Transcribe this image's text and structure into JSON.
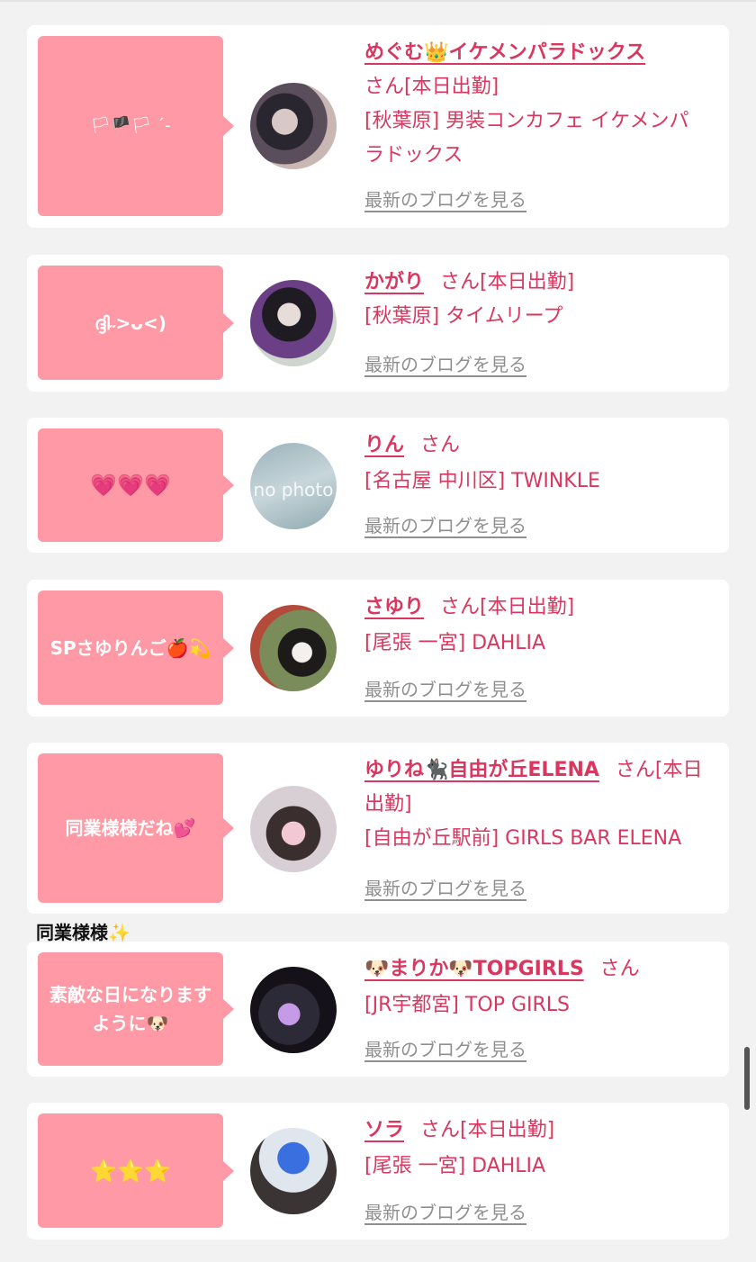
{
  "blog_link_label": "最新のブログを見る",
  "section_label": "同業様様✨",
  "entries": [
    {
      "bubble": "🏳🏴🏳 ˊ-",
      "name": "めぐむ👑イケメンパラドックス",
      "suffix": "さん[本日出勤]",
      "shop": "[秋葉原] 男装コンカフェ イケメンパラドックス"
    },
    {
      "bubble": "ദ്ദി˶>ᴗ<)",
      "name": "かがり",
      "suffix": "さん[本日出勤]",
      "shop": "[秋葉原] タイムリープ"
    },
    {
      "bubble": "💗💗💗",
      "name": "りん",
      "suffix": "さん",
      "shop": "[名古屋 中川区] TWINKLE",
      "avatar_text": "no photo"
    },
    {
      "bubble": "SPさゆりんご🍎💫",
      "name": "さゆり",
      "suffix": "さん[本日出勤]",
      "shop": "[尾張 一宮] DAHLIA"
    },
    {
      "bubble": "同業様様だね💕",
      "name": "ゆりね🐈‍⬛自由が丘ELENA",
      "suffix": "さん[本日出勤]",
      "shop": "[自由が丘駅前] GIRLS BAR ELENA"
    },
    {
      "bubble": "素敵な日になりますように🐶",
      "name": "🐶まりか🐶TOPGIRLS",
      "suffix": "さん",
      "shop": "[JR宇都宮] TOP GIRLS"
    },
    {
      "bubble": "⭐⭐⭐",
      "name": "ソラ",
      "suffix": "さん[本日出勤]",
      "shop": "[尾張 一宮] DAHLIA"
    }
  ]
}
